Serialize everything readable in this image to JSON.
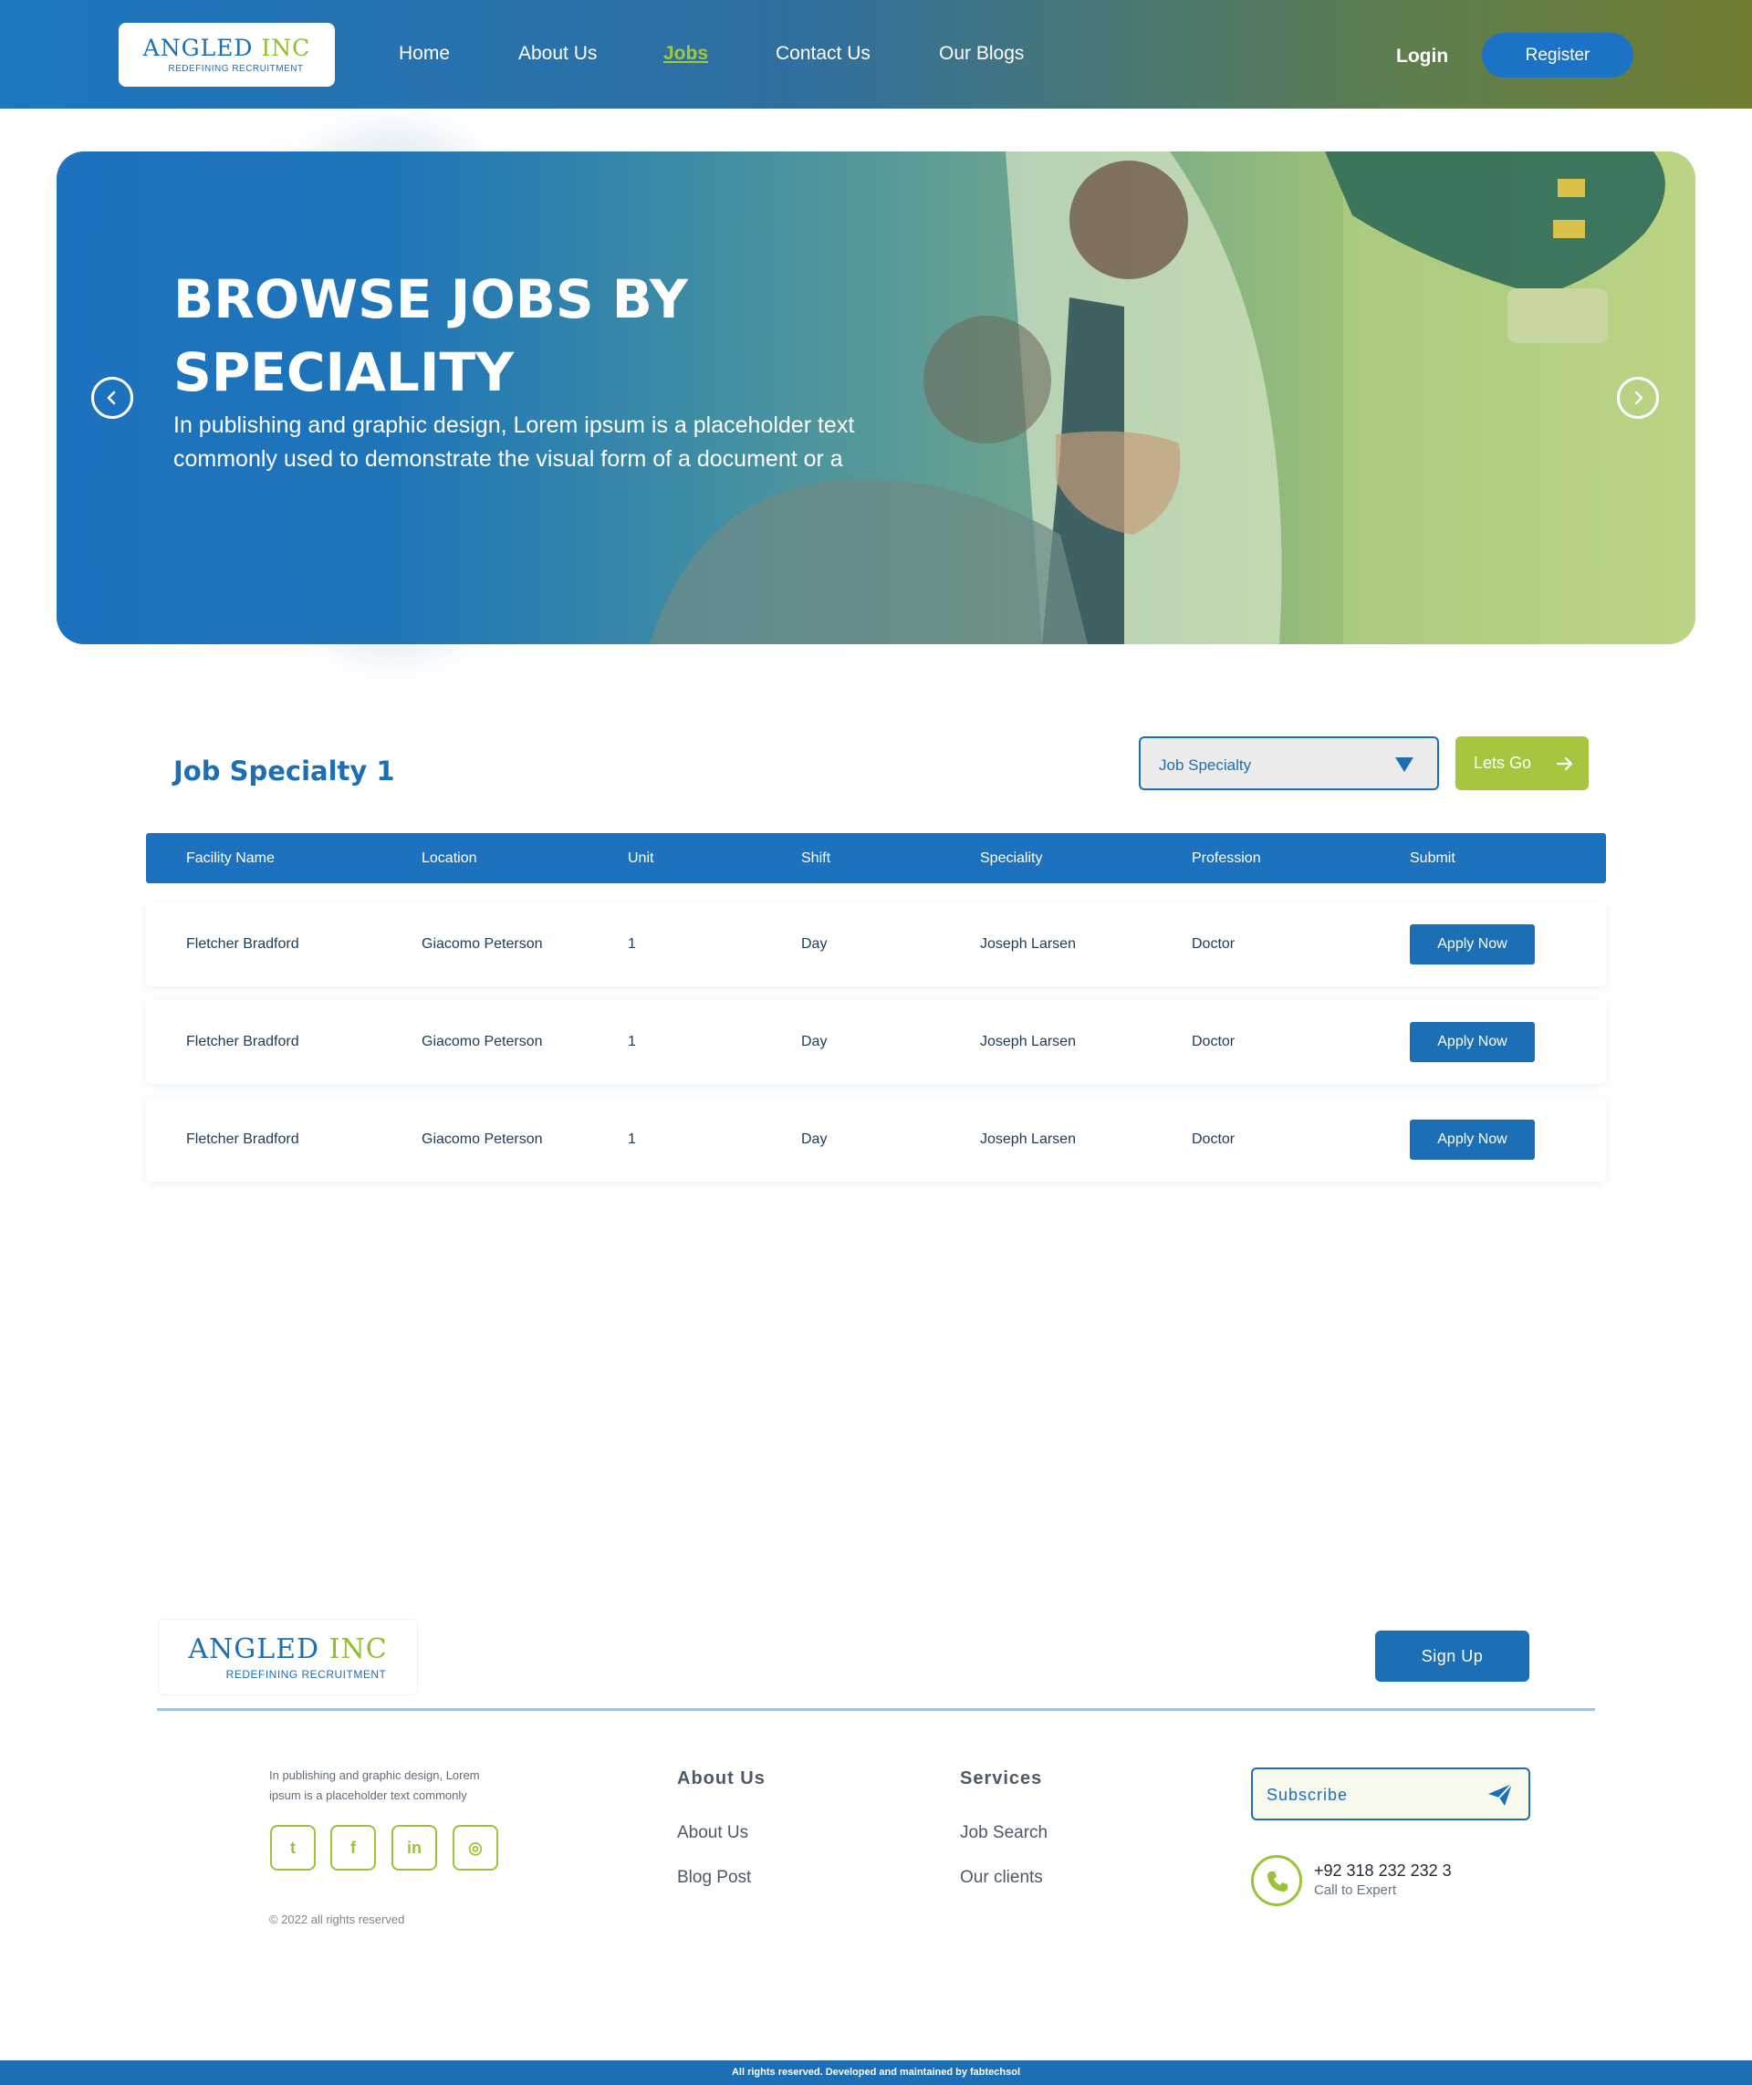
{
  "nav": {
    "logo": {
      "name_part1": "ANGLED",
      "name_part2": "INC",
      "tagline": "REDEFINING RECRUITMENT"
    },
    "links": [
      {
        "label": "Home",
        "active": false
      },
      {
        "label": "About Us",
        "active": false
      },
      {
        "label": "Jobs",
        "active": true
      },
      {
        "label": "Contact Us",
        "active": false
      },
      {
        "label": "Our Blogs",
        "active": false
      }
    ],
    "login_label": "Login",
    "register_label": "Register"
  },
  "hero": {
    "title": "BROWSE JOBS BY SPECIALITY",
    "text": "In publishing and graphic design, Lorem ipsum is a placeholder text commonly used to demonstrate the visual form of a document or a",
    "prev_icon": "chevron-left-icon",
    "next_icon": "chevron-right-icon"
  },
  "jobs": {
    "title": "Job Specialty 1",
    "filter": {
      "selected": "Job Specialty"
    },
    "go_label": "Lets Go",
    "columns": [
      "Facility Name",
      "Location",
      "Unit",
      "Shift",
      "Speciality",
      "Profession",
      "Submit"
    ],
    "rows": [
      {
        "facility": "Fletcher Bradford",
        "location": "Giacomo Peterson",
        "unit": "1",
        "shift": "Day",
        "speciality": "Joseph Larsen",
        "profession": "Doctor",
        "action": "Apply Now"
      },
      {
        "facility": "Fletcher Bradford",
        "location": "Giacomo Peterson",
        "unit": "1",
        "shift": "Day",
        "speciality": "Joseph Larsen",
        "profession": "Doctor",
        "action": "Apply Now"
      },
      {
        "facility": "Fletcher Bradford",
        "location": "Giacomo Peterson",
        "unit": "1",
        "shift": "Day",
        "speciality": "Joseph Larsen",
        "profession": "Doctor",
        "action": "Apply Now"
      }
    ]
  },
  "footer": {
    "logo": {
      "name_part1": "ANGLED",
      "name_part2": "INC",
      "tagline": "REDEFINING RECRUITMENT"
    },
    "signup_label": "Sign Up",
    "description": "In publishing and graphic design, Lorem ipsum is a placeholder text commonly",
    "social": [
      {
        "icon": "twitter-icon",
        "glyph": "t"
      },
      {
        "icon": "facebook-icon",
        "glyph": "f"
      },
      {
        "icon": "linkedin-icon",
        "glyph": "in"
      },
      {
        "icon": "instagram-icon",
        "glyph": "◎"
      }
    ],
    "copyright": "© 2022 all rights reserved",
    "about_heading": "About Us",
    "about_links": [
      "About Us",
      "Blog Post"
    ],
    "services_heading": "Services",
    "services_links": [
      "Job Search",
      "Our clients"
    ],
    "subscribe_placeholder": "Subscribe",
    "phone": "+92 318 232 232 3",
    "phone_caption": "Call to Expert",
    "bottom_text": "All rights reserved. Developed and maintained by fabtechsol"
  },
  "colors": {
    "primary": "#1c6fb5",
    "accent": "#a7c640"
  }
}
